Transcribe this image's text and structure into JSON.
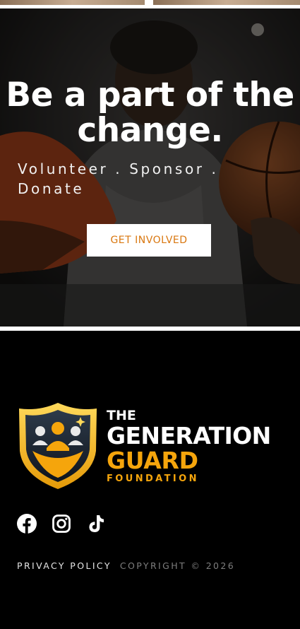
{
  "hero": {
    "title_line1": "Be a part of the",
    "title_line2": "change.",
    "subtitle_line1": "Volunteer . Sponsor .",
    "subtitle_line2": "Donate",
    "cta_label": "GET INVOLVED"
  },
  "footer": {
    "logo": {
      "line1": "THE",
      "line2": "GENERATION",
      "line3": "GUARD",
      "line4": "FOUNDATION"
    },
    "socials": [
      {
        "icon": "facebook-icon"
      },
      {
        "icon": "instagram-icon"
      },
      {
        "icon": "tiktok-icon"
      }
    ],
    "privacy_label": "PRIVACY POLICY",
    "copyright": "COPYRIGHT © 2026"
  },
  "colors": {
    "accent": "#f5a50c",
    "cta_text": "#d9770f",
    "footer_bg": "#000000"
  }
}
